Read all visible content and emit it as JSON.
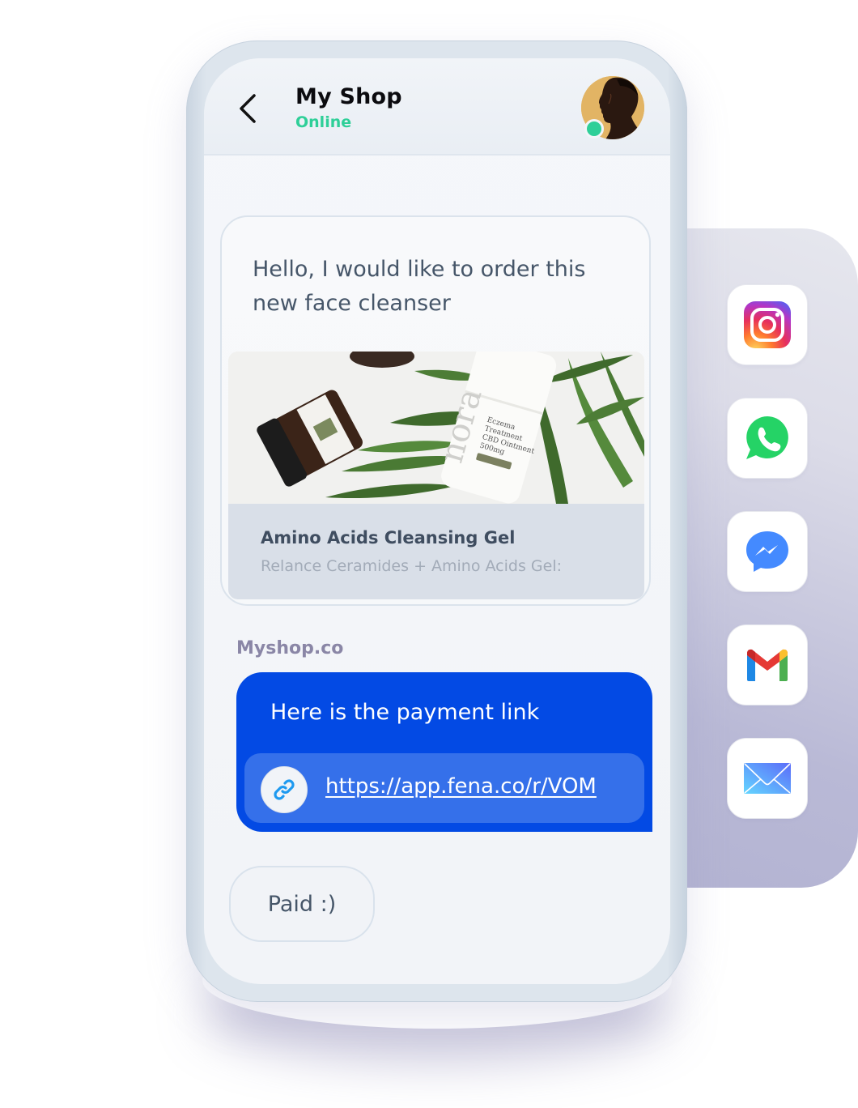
{
  "header": {
    "back_label": "Back",
    "title": "My Shop",
    "status": "Online",
    "status_color": "#2ecf98"
  },
  "messages": {
    "customer": {
      "text": "Hello, I would like to order this new face cleanser",
      "product": {
        "image_alt": "Skincare products: a jar and a white bottle labeled nora Eczema Treatment CBD Ointment 500mg, on palm leaves",
        "name": "Amino Acids Cleansing Gel",
        "description": "Relance Ceramides + Amino Acids Gel:"
      }
    },
    "shop": {
      "sender": "Myshop.co",
      "text": "Here is the payment link",
      "link_url": "https://app.fena.co/r/VOM",
      "bubble_color": "#034ae4"
    },
    "reply": {
      "text": "Paid :)"
    }
  },
  "channels": [
    {
      "name": "Instagram",
      "icon": "instagram-icon"
    },
    {
      "name": "WhatsApp",
      "icon": "whatsapp-icon"
    },
    {
      "name": "Messenger",
      "icon": "messenger-icon"
    },
    {
      "name": "Gmail",
      "icon": "gmail-icon"
    },
    {
      "name": "Mail",
      "icon": "mail-icon"
    }
  ]
}
